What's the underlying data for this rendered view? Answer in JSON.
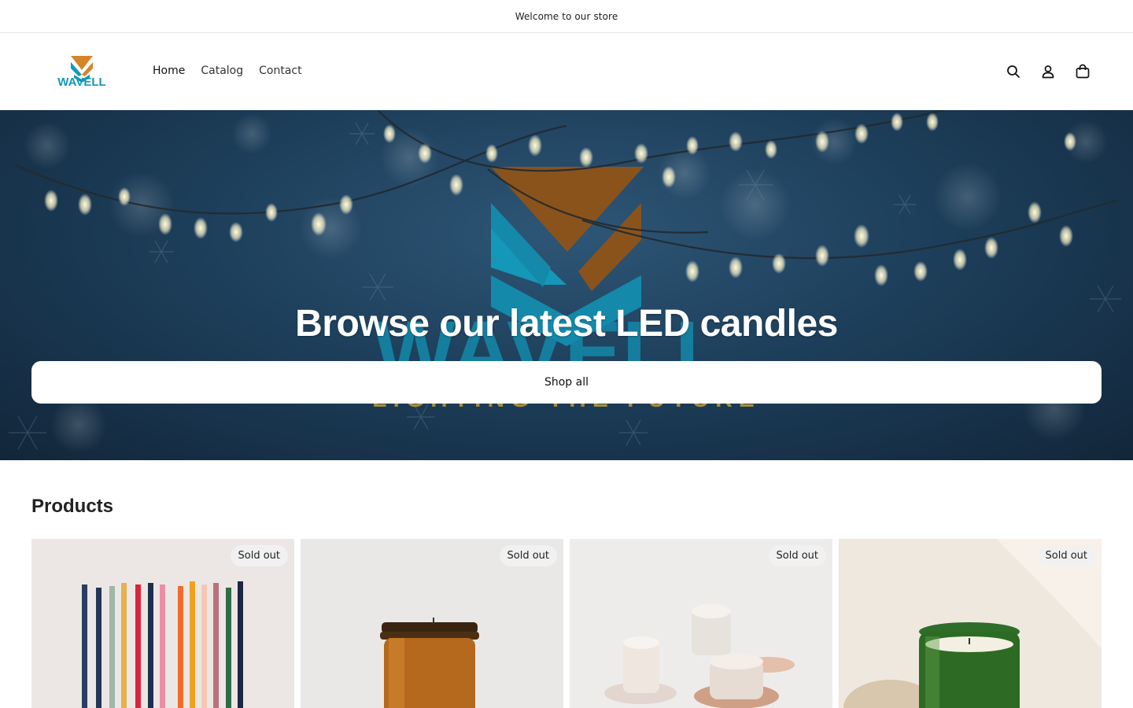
{
  "announcement": {
    "text": "Welcome to our store"
  },
  "header": {
    "logo_text": "WAVELL",
    "nav": [
      {
        "label": "Home"
      },
      {
        "label": "Catalog"
      },
      {
        "label": "Contact"
      }
    ],
    "icons": [
      "search-icon",
      "account-icon",
      "cart-icon"
    ]
  },
  "hero": {
    "title": "Browse our latest LED candles",
    "button_label": "Shop all",
    "background_text": "WAVELL",
    "background_tagline": "LIGHTING THE FUTURE"
  },
  "products": {
    "title": "Products",
    "items": [
      {
        "badge": "Sold out"
      },
      {
        "badge": "Sold out"
      },
      {
        "badge": "Sold out"
      },
      {
        "badge": "Sold out"
      }
    ]
  },
  "colors": {
    "brand_orange": "#8a531c",
    "brand_teal": "#1597b8",
    "hero_bg": "#1d3f5b"
  }
}
